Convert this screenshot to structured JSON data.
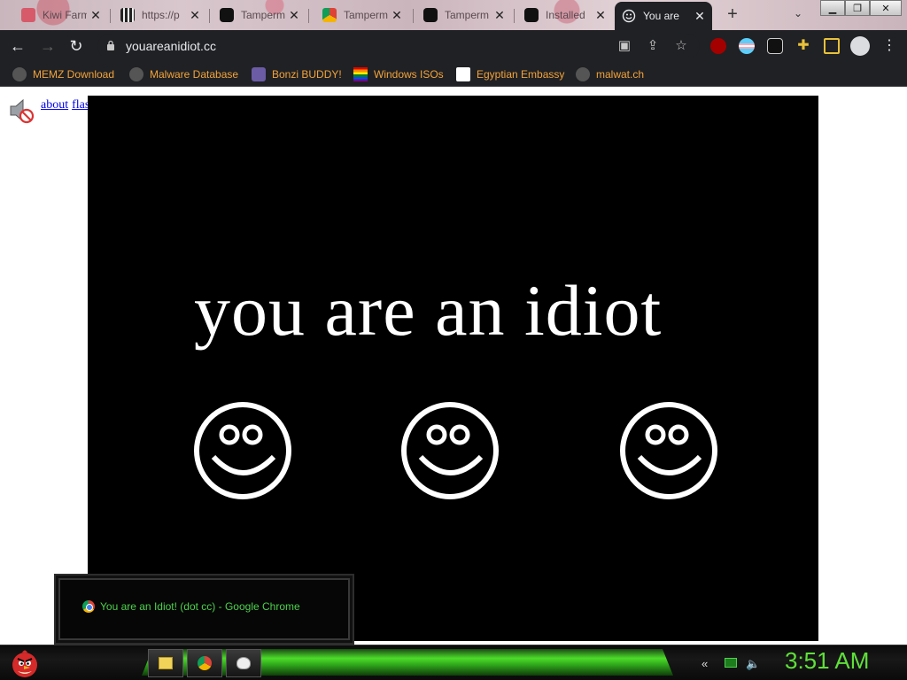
{
  "browser": {
    "tabs": [
      {
        "title": "Kiwi Farm",
        "favicon": "kiwi-icon"
      },
      {
        "title": "https://p",
        "favicon": "qr-icon"
      },
      {
        "title": "Tamperm",
        "favicon": "tampermonkey-icon"
      },
      {
        "title": "Tamperm",
        "favicon": "chrome-store-icon"
      },
      {
        "title": "Tamperm",
        "favicon": "tampermonkey-icon"
      },
      {
        "title": "Installed",
        "favicon": "tampermonkey-icon"
      },
      {
        "title": "You are a",
        "favicon": "smiley-icon",
        "active": true
      }
    ],
    "new_tab_label": "+",
    "url": "youareanidiot.cc",
    "bookmarks": [
      {
        "label": "MEMZ Download",
        "icon": "globe-icon"
      },
      {
        "label": "Malware Database",
        "icon": "globe-icon"
      },
      {
        "label": "Bonzi BUDDY!",
        "icon": "bonzi-icon"
      },
      {
        "label": "Windows ISOs",
        "icon": "rainbow-flag-icon"
      },
      {
        "label": "Egyptian Embassy",
        "icon": "wix-icon"
      },
      {
        "label": "malwat.ch",
        "icon": "globe-icon"
      }
    ]
  },
  "page": {
    "links": [
      "about",
      "flash"
    ],
    "headline": "you are an idiot",
    "smiley_count": 3
  },
  "taskbar": {
    "preview_title": "You are an Idiot! (dot cc) - Google Chrome",
    "clock": "3:51 AM"
  },
  "colors": {
    "bookmark_text": "#f2a33a",
    "accent_green": "#5fe03a",
    "chrome_dark": "#202124"
  }
}
